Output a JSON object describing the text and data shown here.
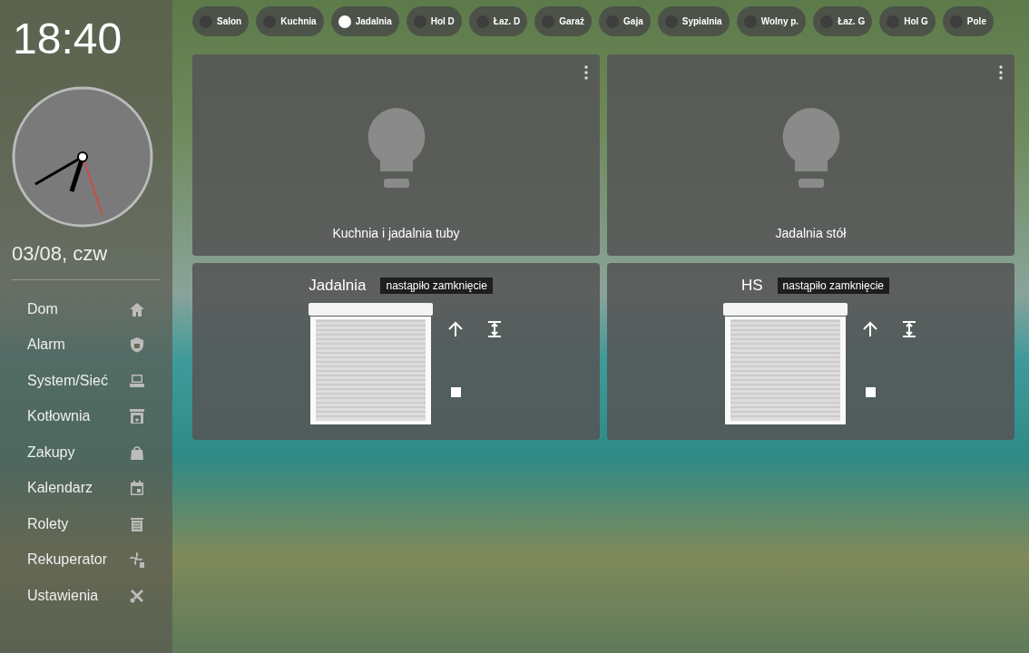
{
  "sidebar": {
    "time": "18:40",
    "date": "03/08, czw",
    "items": [
      {
        "label": "Dom"
      },
      {
        "label": "Alarm"
      },
      {
        "label": "System/Sieć"
      },
      {
        "label": "Kotłownia"
      },
      {
        "label": "Zakupy"
      },
      {
        "label": "Kalendarz"
      },
      {
        "label": "Rolety"
      },
      {
        "label": "Rekuperator"
      },
      {
        "label": "Ustawienia"
      }
    ]
  },
  "rooms": [
    {
      "label": "Salon",
      "selected": false
    },
    {
      "label": "Kuchnia",
      "selected": false
    },
    {
      "label": "Jadalnia",
      "selected": true
    },
    {
      "label": "Hol D",
      "selected": false
    },
    {
      "label": "Łaz. D",
      "selected": false
    },
    {
      "label": "Garaż",
      "selected": false
    },
    {
      "label": "Gaja",
      "selected": false
    },
    {
      "label": "Sypialnia",
      "selected": false
    },
    {
      "label": "Wolny p.",
      "selected": false
    },
    {
      "label": "Łaz. G",
      "selected": false
    },
    {
      "label": "Hol G",
      "selected": false
    },
    {
      "label": "Pole",
      "selected": false
    }
  ],
  "lights": [
    {
      "name": "Kuchnia i jadalnia tuby"
    },
    {
      "name": "Jadalnia stół"
    }
  ],
  "covers": [
    {
      "name": "Jadalnia",
      "status": "nastąpiło zamknięcie"
    },
    {
      "name": "HS",
      "status": "nastąpiło zamknięcie"
    }
  ]
}
